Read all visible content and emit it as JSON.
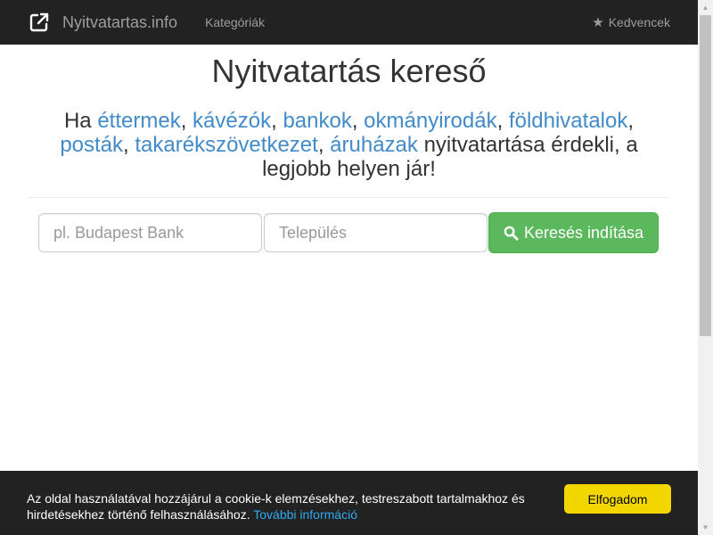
{
  "navbar": {
    "brand_icon": "external-link-icon",
    "brand": "Nyitvatartas.info",
    "categories": "Kategóriák",
    "favorites_icon": "star-icon",
    "favorites": "Kedvencek"
  },
  "main": {
    "title": "Nyitvatartás kereső",
    "lead_prefix": "Ha",
    "links": [
      "éttermek",
      "kávézók",
      "bankok",
      "okmányirodák",
      "földhivatalok",
      "posták",
      "takarékszövetkezet",
      "áruházak"
    ],
    "lead_suffix": "nyitvatartása érdekli, a legjobb helyen jár!"
  },
  "search": {
    "name_placeholder": "pl. Budapest Bank",
    "city_placeholder": "Település",
    "button_icon": "search-icon",
    "button_label": "Keresés indítása"
  },
  "cookie": {
    "text": "Az oldal használatával hozzájárul a cookie-k elemzésekhez, testreszabott tartalmakhoz és hirdetésekhez történő felhasználásához.",
    "more_info": "További információ",
    "accept": "Elfogadom"
  },
  "colors": {
    "navbar": "#222222",
    "link": "#428bca",
    "search_button": "#5cb85c",
    "cookie_button": "#f1d600",
    "cookie_link": "#31a8f0"
  }
}
